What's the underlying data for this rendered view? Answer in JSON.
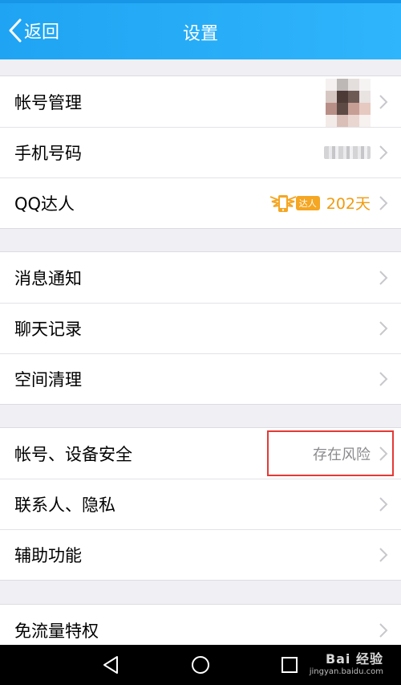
{
  "header": {
    "back_label": "返回",
    "title": "设置",
    "color": "#2aabf7"
  },
  "groups": [
    {
      "items": [
        {
          "label": "帐号管理",
          "right": "avatar"
        },
        {
          "label": "手机号码",
          "right": "blurred-number"
        },
        {
          "label": "QQ达人",
          "right": "badge",
          "badge_tag": "达人",
          "days": "202天"
        }
      ]
    },
    {
      "items": [
        {
          "label": "消息通知"
        },
        {
          "label": "聊天记录"
        },
        {
          "label": "空间清理"
        }
      ]
    },
    {
      "items": [
        {
          "label": "帐号、设备安全",
          "status": "存在风险",
          "highlighted": true
        },
        {
          "label": "联系人、隐私"
        },
        {
          "label": "辅助功能"
        }
      ]
    },
    {
      "items": [
        {
          "label": "免流量特权"
        }
      ]
    }
  ],
  "navbar": {
    "buttons": [
      "back-triangle-icon",
      "home-circle-icon",
      "recents-square-icon"
    ]
  },
  "watermark": {
    "main": "Bai 经验",
    "sub": "jingyan.baidu.com"
  },
  "colors": {
    "accent": "#1fa4f3",
    "badge": "#f5a623",
    "risk_box": "#e53935"
  }
}
